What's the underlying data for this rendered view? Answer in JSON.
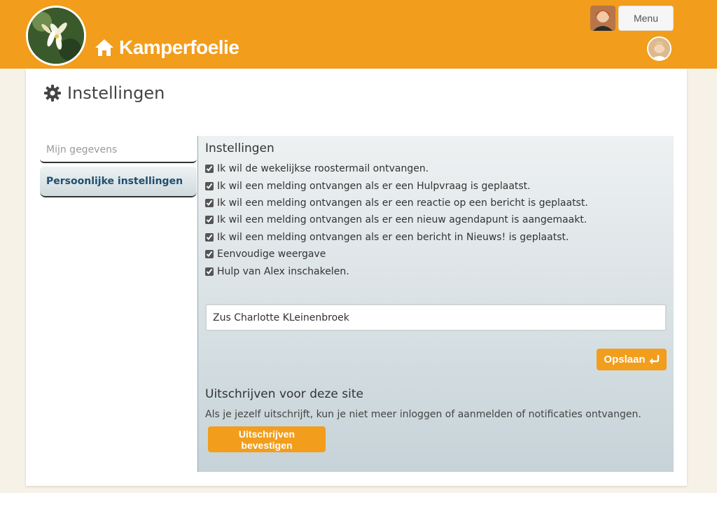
{
  "header": {
    "site_title": "Kamperfoelie",
    "menu_label": "Menu",
    "brand_color": "#f29d1b"
  },
  "page": {
    "heading": "Instellingen"
  },
  "sidebar": {
    "items": [
      {
        "label": "Mijn gegevens",
        "active": false
      },
      {
        "label": "Persoonlijke instellingen",
        "active": true
      }
    ]
  },
  "settings": {
    "title": "Instellingen",
    "options": [
      {
        "label": "Ik wil de wekelijkse roostermail ontvangen.",
        "checked": true
      },
      {
        "label": "Ik wil een melding ontvangen als er een Hulpvraag is geplaatst.",
        "checked": true
      },
      {
        "label": "Ik wil een melding ontvangen als er een reactie op een bericht is geplaatst.",
        "checked": true
      },
      {
        "label": "Ik wil een melding ontvangen als er een nieuw agendapunt is aangemaakt.",
        "checked": true
      },
      {
        "label": "Ik wil een melding ontvangen als er een bericht in Nieuws! is geplaatst.",
        "checked": true
      },
      {
        "label": "Eenvoudige weergave",
        "checked": true
      },
      {
        "label": "Hulp van Alex inschakelen.",
        "checked": true
      }
    ],
    "name_value": "Zus Charlotte KLeinenbroek",
    "save_label": "Opslaan"
  },
  "unsubscribe": {
    "title": "Uitschrijven voor deze site",
    "text": "Als je jezelf uitschrijft, kun je niet meer inloggen of aanmelden of notificaties ontvangen.",
    "button_label": "Uitschrijven bevestigen"
  }
}
